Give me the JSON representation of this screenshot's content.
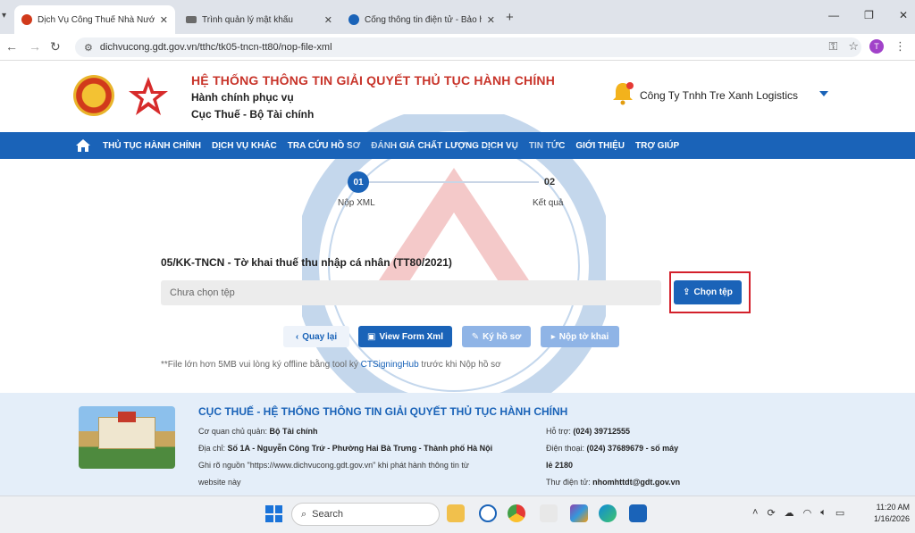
{
  "browser": {
    "tabs": [
      {
        "title": "Dịch Vụ Công Thuế Nhà Nước",
        "favicon_color": "#d13a1b"
      },
      {
        "title": "Trình quản lý mật khẩu",
        "favicon_color": "#6b6b6b"
      },
      {
        "title": "Cổng thông tin điện tử - Bảo hi",
        "favicon_color": "#1a63b8"
      }
    ],
    "url": "dichvucong.gdt.gov.vn/tthc/tk05-tncn-tt80/nop-file-xml",
    "profile_initial": "T"
  },
  "header": {
    "title": "HỆ THỐNG THÔNG TIN GIẢI QUYẾT THỦ TỤC HÀNH CHÍNH",
    "subtitle1": "Hành chính phục vụ",
    "subtitle2": "Cục Thuế - Bộ Tài chính",
    "company": "Công Ty Tnhh Tre Xanh Logistics"
  },
  "nav": {
    "items": [
      "THỦ TỤC HÀNH CHÍNH",
      "DỊCH VỤ KHÁC",
      "TRA CỨU HỒ SƠ",
      "ĐÁNH GIÁ CHẤT LƯỢNG DỊCH VỤ",
      "TIN TỨC",
      "GIỚI THIỆU",
      "TRỢ GIÚP"
    ]
  },
  "steps": {
    "step1_num": "01",
    "step1_label": "Nộp XML",
    "step2_num": "02",
    "step2_label": "Kết quả"
  },
  "form": {
    "title": "05/KK-TNCN - Tờ khai thuế thu nhập cá nhân (TT80/2021)",
    "file_placeholder": "Chưa chọn tệp",
    "choose_label": "Chọn tệp",
    "back_label": "Quay lại",
    "view_label": "View Form Xml",
    "sign_label": "Ký hồ sơ",
    "submit_label": "Nộp tờ khai",
    "note_prefix": "**File lớn hơn 5MB vui lòng ký offline bằng tool ký ",
    "note_link": "CTSigningHub",
    "note_suffix": " trước khi Nộp hồ sơ"
  },
  "footer": {
    "title": "CỤC THUẾ - HỆ THỐNG THÔNG TIN GIẢI QUYẾT THỦ TỤC HÀNH CHÍNH",
    "owner_label": "Cơ quan chủ quản:",
    "owner_value": "Bộ Tài chính",
    "address_label": "Địa chỉ:",
    "address_value": "Số 1A - Nguyễn Công Trứ - Phường Hai Bà Trưng - Thành phố Hà Nội",
    "source_line1": "Ghi rõ nguồn \"https://www.dichvucong.gdt.gov.vn\" khi phát hành thông tin từ",
    "source_line2": "website này",
    "support_label": "Hỗ trợ:",
    "support_value": "(024) 39712555",
    "phone_label": "Điện thoại:",
    "phone_value": "(024) 37689679 - số máy",
    "phone_ext": "lẻ 2180",
    "email_label": "Thư điện tử:",
    "email_value": "nhomhttdt@gdt.gov.vn"
  },
  "taskbar": {
    "search_placeholder": "Search",
    "time": "11:20 AM",
    "date": "1/16/2026"
  },
  "colors": {
    "primary": "#1a63b8",
    "title_red": "#c8342a",
    "highlight": "#d3202b"
  }
}
